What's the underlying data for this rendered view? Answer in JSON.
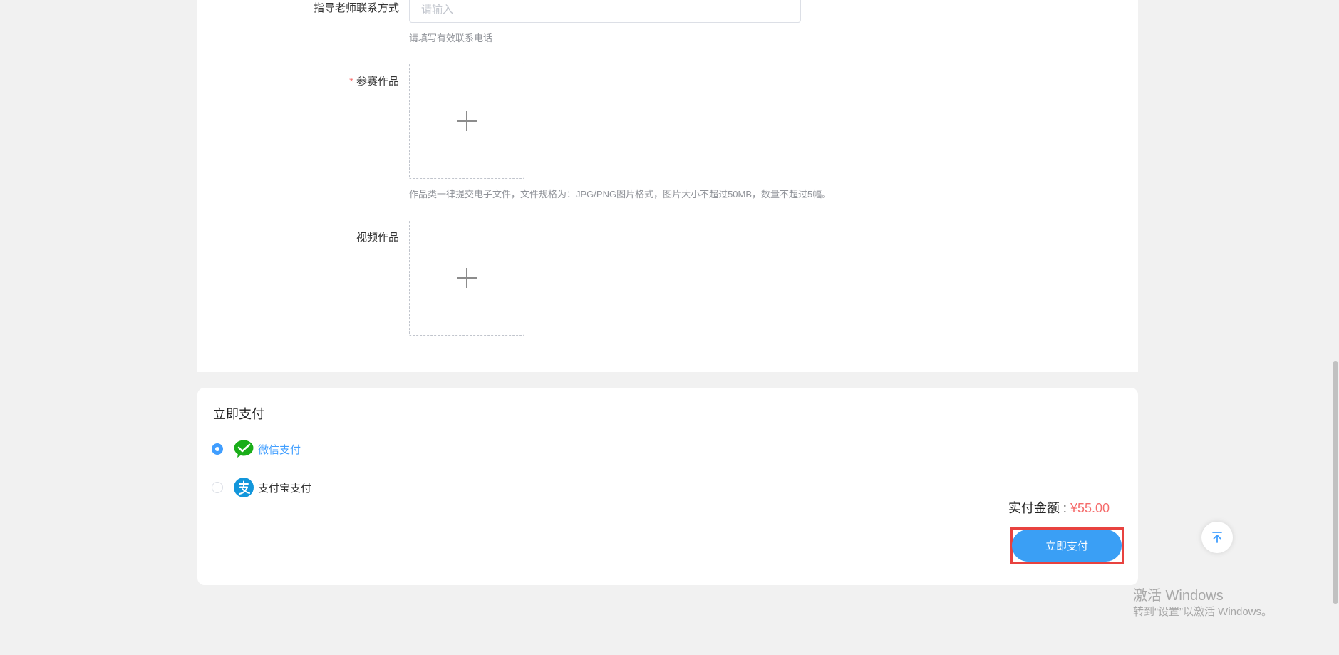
{
  "form": {
    "teacher_contact": {
      "label": "指导老师联系方式",
      "placeholder": "请输入",
      "value": "",
      "hint": "请填写有效联系电话"
    },
    "entry_works": {
      "required_mark": "*",
      "label": "参赛作品",
      "hint": "作品类一律提交电子文件，文件规格为：JPG/PNG图片格式，图片大小不超过50MB，数量不超过5幅。"
    },
    "video_works": {
      "label": "视频作品"
    }
  },
  "payment": {
    "title": "立即支付",
    "options": [
      {
        "label": "微信支付",
        "icon": "wechat-pay-icon",
        "selected": true
      },
      {
        "label": "支付宝支付",
        "icon": "alipay-icon",
        "selected": false
      }
    ],
    "amount_label": "实付金额 : ",
    "amount_value": "¥55.00",
    "pay_button": "立即支付"
  },
  "watermark": {
    "line1": "激活 Windows",
    "line2": "转到“设置”以激活 Windows。"
  },
  "colors": {
    "accent": "#409eff",
    "pay_button": "#3a9ff5",
    "price": "#f56c6c",
    "highlight_frame": "#e8423f",
    "wechat_green": "#1aad19",
    "alipay_blue": "#1296db"
  }
}
